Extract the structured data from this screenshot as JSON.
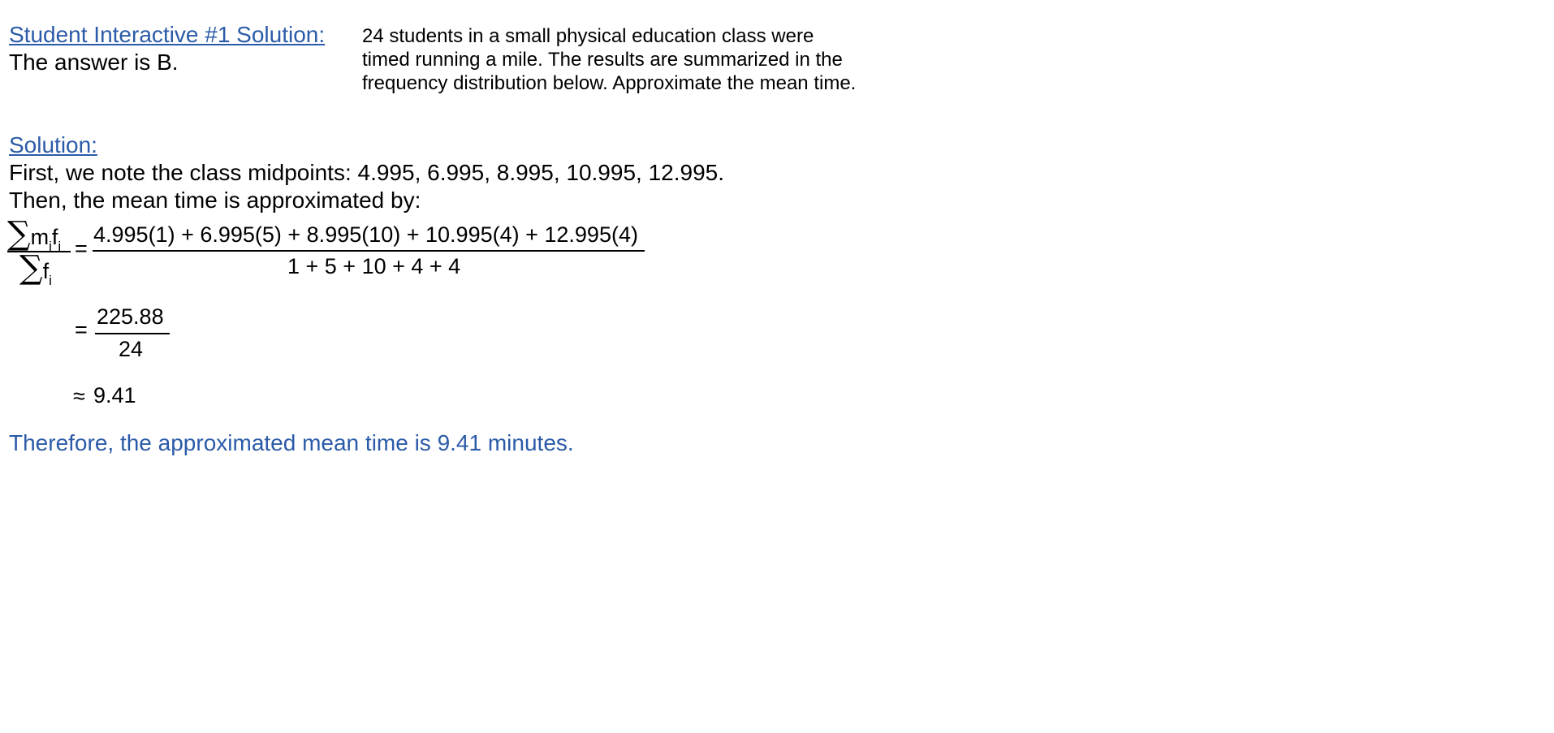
{
  "header": {
    "title": "Student Interactive #1 Solution:",
    "answer": "The answer is B."
  },
  "problem": {
    "lines": [
      "24 students in a small physical education class were",
      "timed running a mile.  The results are summarized in the",
      "frequency distribution below.  Approximate the mean time."
    ]
  },
  "solution": {
    "heading": "Solution:",
    "line1": "First, we note the class midpoints:  4.995, 6.995, 8.995, 10.995, 12.995.",
    "line2": "Then, the mean time is approximated by:"
  },
  "math": {
    "sigma": "∑",
    "lhs_num_m": "m",
    "lhs_num_f": "f",
    "sub_i": "i",
    "lhs_den_f": "f",
    "eq": "=",
    "rhs_numerator": "4.995(1) + 6.995(5) + 8.995(10) + 10.995(4) + 12.995(4)",
    "rhs_denominator": "1 + 5 + 10 + 4 + 4",
    "step2_numerator": "225.88",
    "step2_denominator": "24",
    "approx": "≈",
    "result": "9.41"
  },
  "conclusion": "Therefore, the approximated mean time is 9.41 minutes."
}
